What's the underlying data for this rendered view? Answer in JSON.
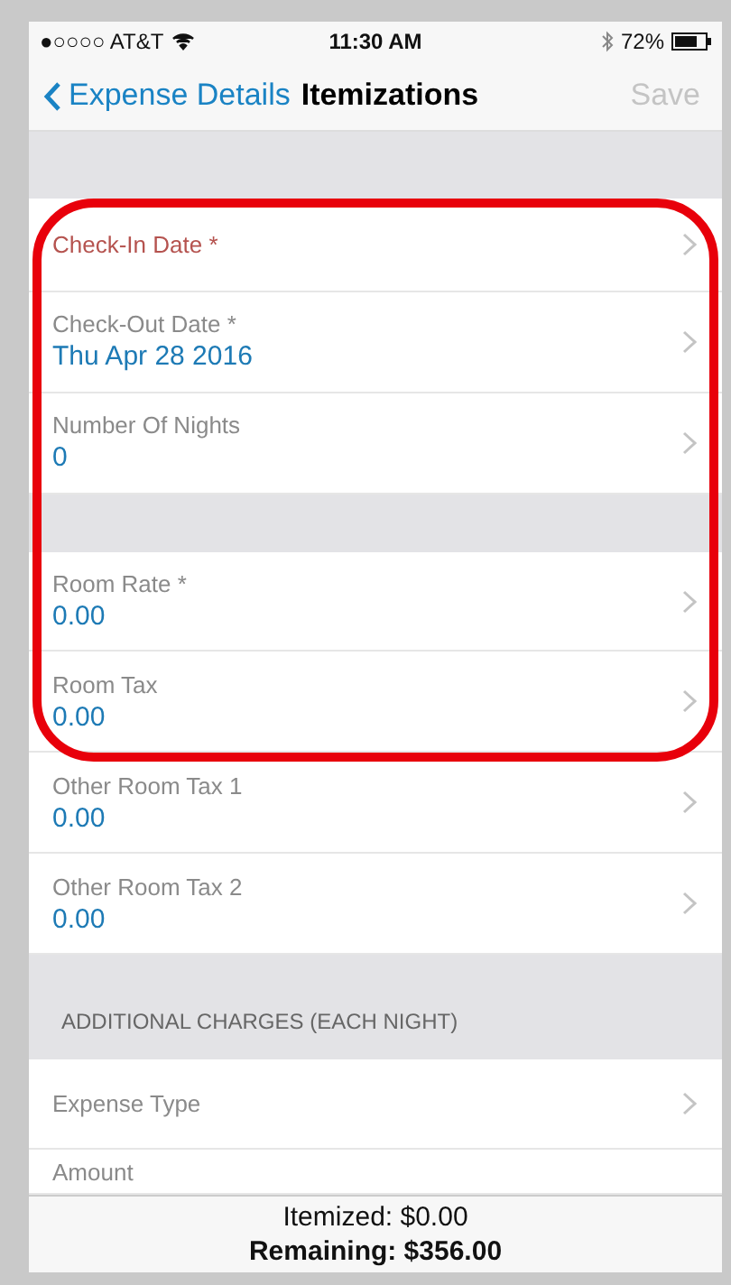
{
  "status_bar": {
    "carrier": "●○○○○ AT&T",
    "time": "11:30 AM",
    "battery": "72%"
  },
  "nav": {
    "back": "Expense Details",
    "title": "Itemizations",
    "action": "Save",
    "action_disabled": true
  },
  "sections": [
    {
      "rows": [
        {
          "label": "Check-In Date *",
          "value": null,
          "error": true
        },
        {
          "label": "Check-Out Date *",
          "value": "Thu Apr 28 2016",
          "error": false
        },
        {
          "label": "Number Of Nights",
          "value": "0",
          "error": false
        }
      ]
    },
    {
      "rows": [
        {
          "label": "Room Rate *",
          "value": "0.00",
          "error": false
        },
        {
          "label": "Room Tax",
          "value": "0.00",
          "error": false
        },
        {
          "label": "Other Room Tax 1",
          "value": "0.00",
          "error": false
        },
        {
          "label": "Other Room Tax 2",
          "value": "0.00",
          "error": false
        }
      ]
    },
    {
      "header": "ADDITIONAL CHARGES (EACH NIGHT)",
      "rows": [
        {
          "label": "Expense Type",
          "value": null,
          "error": false
        },
        {
          "label": "Amount",
          "value": null,
          "error": false,
          "chevron": false
        }
      ]
    }
  ],
  "footer": {
    "itemized": "Itemized: $0.00",
    "remaining": "Remaining: $356.00"
  },
  "annotation": {
    "color": "#e8000b"
  }
}
